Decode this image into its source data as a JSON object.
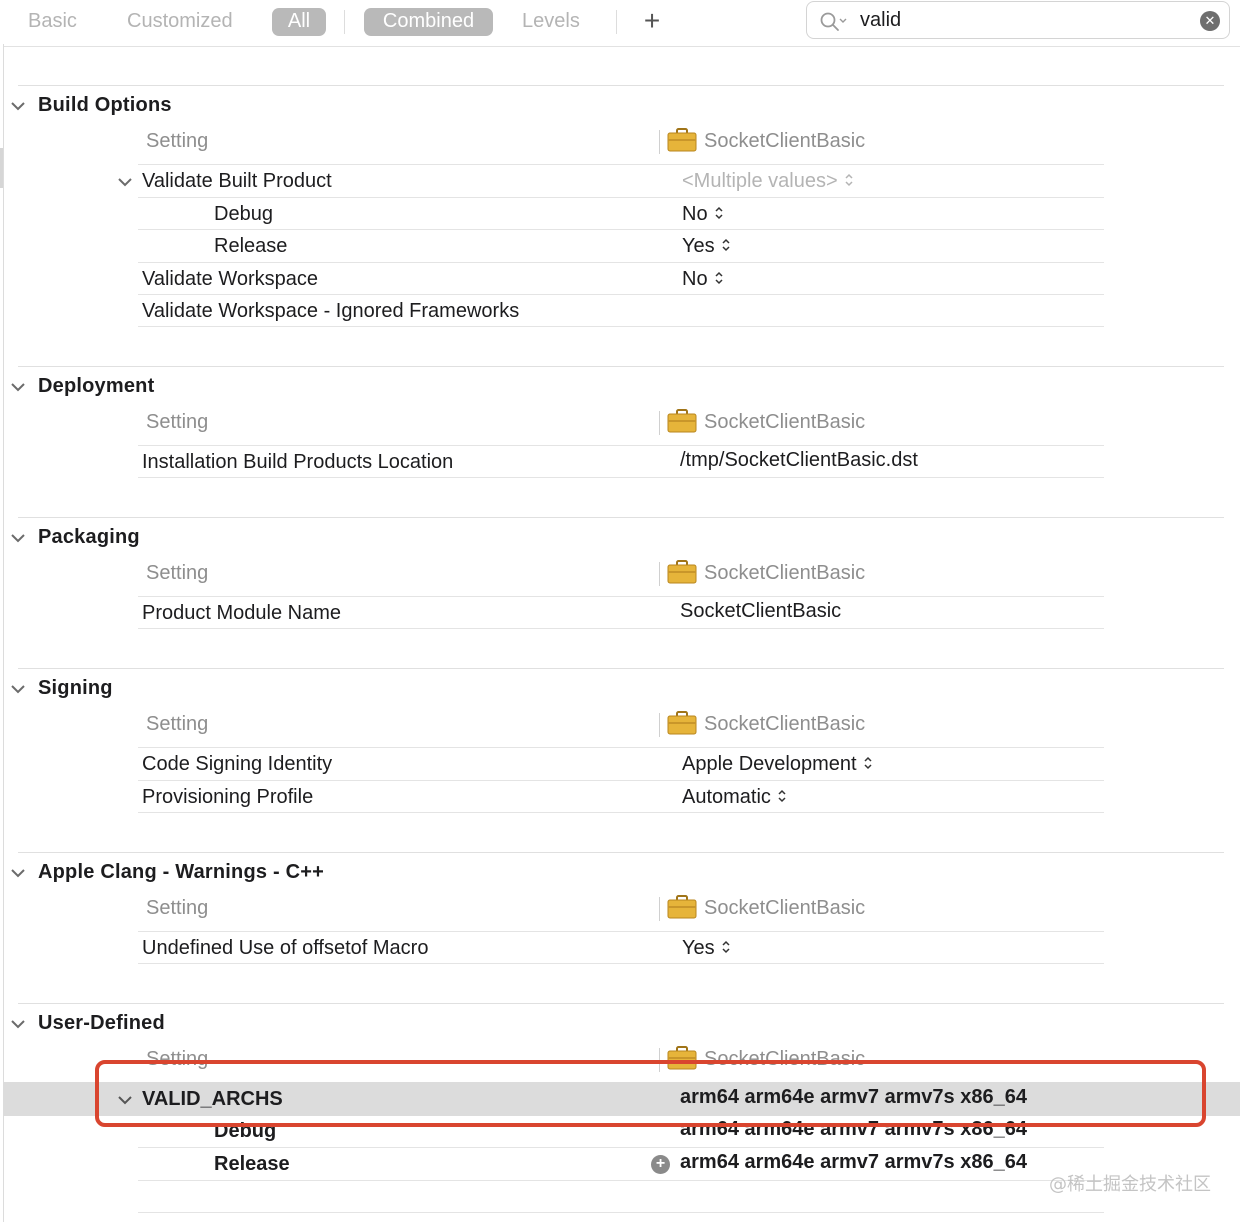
{
  "toolbar": {
    "basic": "Basic",
    "customized": "Customized",
    "all": "All",
    "combined": "Combined",
    "levels": "Levels",
    "add": "+",
    "search_value": "valid"
  },
  "colors": {
    "selected_pill": "#b9b9b9",
    "highlight_row": "#dcdcdc",
    "annotation_box": "#d9452f",
    "target_icon": "#e6b43a"
  },
  "column_headers": {
    "setting": "Setting",
    "target": "SocketClientBasic"
  },
  "sections": [
    {
      "title": "Build Options",
      "rows": [
        {
          "label": "Validate Built Product",
          "value": "<Multiple values>"
        },
        {
          "label": "Debug",
          "value": "No"
        },
        {
          "label": "Release",
          "value": "Yes"
        },
        {
          "label": "Validate Workspace",
          "value": "No"
        },
        {
          "label": "Validate Workspace - Ignored Frameworks",
          "value": ""
        }
      ]
    },
    {
      "title": "Deployment",
      "rows": [
        {
          "label": "Installation Build Products Location",
          "value": "/tmp/SocketClientBasic.dst"
        }
      ]
    },
    {
      "title": "Packaging",
      "rows": [
        {
          "label": "Product Module Name",
          "value": "SocketClientBasic"
        }
      ]
    },
    {
      "title": "Signing",
      "rows": [
        {
          "label": "Code Signing Identity",
          "value": "Apple Development"
        },
        {
          "label": "Provisioning Profile",
          "value": "Automatic"
        }
      ]
    },
    {
      "title": "Apple Clang - Warnings - C++",
      "rows": [
        {
          "label": "Undefined Use of offsetof Macro",
          "value": "Yes"
        }
      ]
    },
    {
      "title": "User-Defined",
      "rows": [
        {
          "label": "VALID_ARCHS",
          "value": "arm64 arm64e armv7 armv7s x86_64"
        },
        {
          "label": "Debug",
          "value": "arm64 arm64e armv7 armv7s x86_64"
        },
        {
          "label": "Release",
          "value": "arm64 arm64e armv7 armv7s x86_64"
        }
      ]
    }
  ],
  "watermark": "@稀土掘金技术社区"
}
